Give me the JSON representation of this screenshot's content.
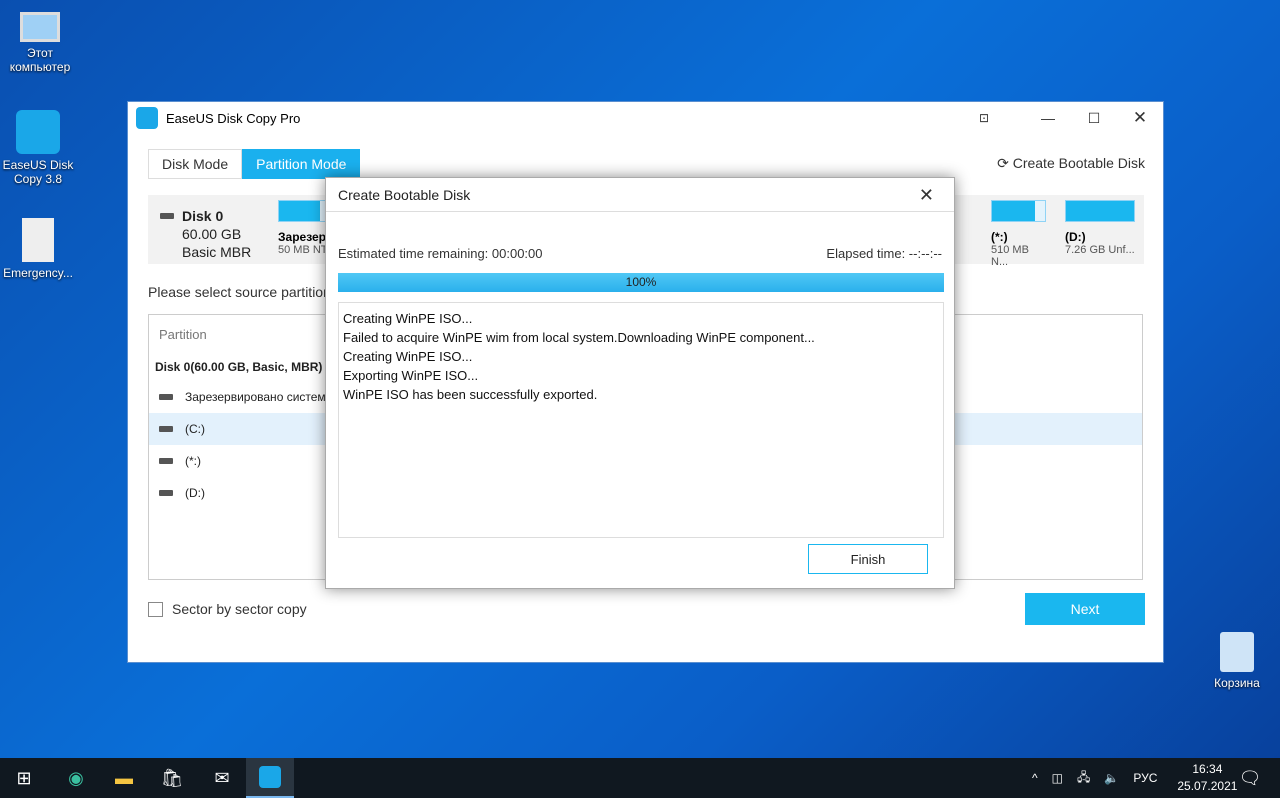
{
  "desktop": {
    "icons": [
      {
        "label": "Этот компьютер"
      },
      {
        "label": "EaseUS Disk Copy 3.8"
      },
      {
        "label": "Emergency..."
      },
      {
        "label": "Корзина"
      }
    ]
  },
  "window": {
    "title": "EaseUS Disk Copy Pro",
    "tabs": [
      "Disk Mode",
      "Partition Mode"
    ],
    "active_tab": "Partition Mode",
    "create_bootable": "Create Bootable Disk",
    "disk": {
      "name": "Disk 0",
      "size": "60.00 GB",
      "type": "Basic MBR"
    },
    "partitions": [
      {
        "label": "Зарезер",
        "info": "50 MB NT",
        "fill": 70
      },
      {
        "label": "(*:)",
        "info": "510 MB N...",
        "fill": 82
      },
      {
        "label": "(D:)",
        "info": "7.26 GB Unf...",
        "fill": 100
      }
    ],
    "prompt": "Please select source partition",
    "list": {
      "header": "Partition",
      "disk_row": "Disk 0(60.00 GB, Basic, MBR)",
      "rows": [
        "Зарезервировано системо",
        "(C:)",
        "(*:)",
        "(D:)"
      ]
    },
    "sector_copy": "Sector by sector copy",
    "next": "Next"
  },
  "dialog": {
    "title": "Create Bootable Disk",
    "estimated": "Estimated time remaining: 00:00:00",
    "elapsed": "Elapsed time: --:--:--",
    "progress_label": "100%",
    "progress": 100,
    "log": [
      "Creating WinPE ISO...",
      "Failed to acquire WinPE wim from local system.Downloading WinPE component...",
      "Creating WinPE ISO...",
      "Exporting WinPE ISO...",
      "WinPE ISO has been successfully exported."
    ],
    "finish": "Finish"
  },
  "taskbar": {
    "lang": "РУС",
    "time": "16:34",
    "date": "25.07.2021"
  },
  "colors": {
    "accent": "#1ab7ef",
    "desktop": "#0a64c8"
  }
}
